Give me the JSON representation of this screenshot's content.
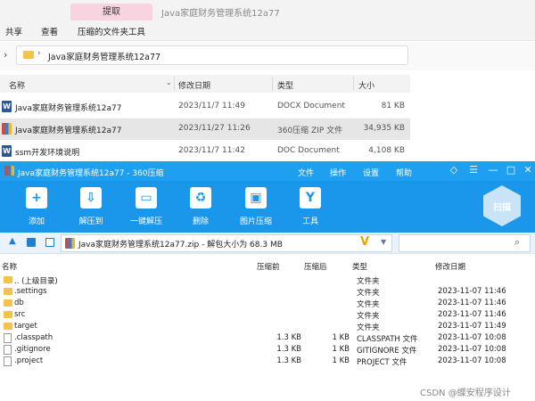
{
  "explorer": {
    "extract_tab": "提取",
    "title": "Java家庭财务管理系统12a77",
    "ribbon": [
      "共享",
      "查看",
      "压缩的文件夹工具"
    ],
    "address": "Java家庭财务管理系统12a77",
    "columns": [
      "名称",
      "修改日期",
      "类型",
      "大小"
    ],
    "rows": [
      {
        "name": "Java家庭财务管理系统12a77",
        "date": "2023/11/7 11:49",
        "type": "DOCX Document",
        "size": "81 KB",
        "icon": "word-icon",
        "selected": false
      },
      {
        "name": "Java家庭财务管理系统12a77",
        "date": "2023/11/27 11:26",
        "type": "360压缩 ZIP 文件",
        "size": "34,935 KB",
        "icon": "zip-icon",
        "selected": true
      },
      {
        "name": "ssm开发环境说明",
        "date": "2023/11/7 11:42",
        "type": "DOC Document",
        "size": "4,108 KB",
        "icon": "word-icon",
        "selected": false
      }
    ]
  },
  "zip": {
    "title": "Java家庭财务管理系统12a77 - 360压缩",
    "menu": [
      "文件",
      "操作",
      "设置",
      "帮助"
    ],
    "window_buttons": [
      "◇",
      "☰",
      "—",
      "□",
      "✕"
    ],
    "tools": [
      {
        "label": "添加",
        "icon": "add-icon",
        "glyph": "+"
      },
      {
        "label": "解压到",
        "icon": "extract-to-icon",
        "glyph": "⇩"
      },
      {
        "label": "一键解压",
        "icon": "one-click-extract-icon",
        "glyph": "▭"
      },
      {
        "label": "删除",
        "icon": "recycle-icon",
        "glyph": "♻"
      },
      {
        "label": "图片压缩",
        "icon": "image-compress-icon",
        "glyph": "▣"
      },
      {
        "label": "工具",
        "icon": "tools-icon",
        "glyph": "Y"
      }
    ],
    "scan_label": "扫描",
    "path": "Java家庭财务管理系统12a77.zip - 解包大小为 68.3 MB",
    "columns": [
      "名称",
      "压缩前",
      "压缩后",
      "类型",
      "修改日期"
    ],
    "rows": [
      {
        "name": ".. (上级目录)",
        "before": "",
        "after": "",
        "type": "文件夹",
        "date": "",
        "kind": "folder"
      },
      {
        "name": ".settings",
        "before": "",
        "after": "",
        "type": "文件夹",
        "date": "2023-11-07 11:46",
        "kind": "folder"
      },
      {
        "name": "db",
        "before": "",
        "after": "",
        "type": "文件夹",
        "date": "2023-11-07 11:46",
        "kind": "folder"
      },
      {
        "name": "src",
        "before": "",
        "after": "",
        "type": "文件夹",
        "date": "2023-11-07 11:46",
        "kind": "folder"
      },
      {
        "name": "target",
        "before": "",
        "after": "",
        "type": "文件夹",
        "date": "2023-11-07 11:49",
        "kind": "folder"
      },
      {
        "name": ".classpath",
        "before": "1.3 KB",
        "after": "1 KB",
        "type": "CLASSPATH 文件",
        "date": "2023-11-07 10:08",
        "kind": "file"
      },
      {
        "name": ".gitignore",
        "before": "1.3 KB",
        "after": "1 KB",
        "type": "GITIGNORE 文件",
        "date": "2023-11-07 10:08",
        "kind": "file"
      },
      {
        "name": ".project",
        "before": "1.3 KB",
        "after": "1 KB",
        "type": "PROJECT 文件",
        "date": "2023-11-07 10:08",
        "kind": "file"
      }
    ]
  },
  "watermark": "CSDN @蝶安程序设计"
}
